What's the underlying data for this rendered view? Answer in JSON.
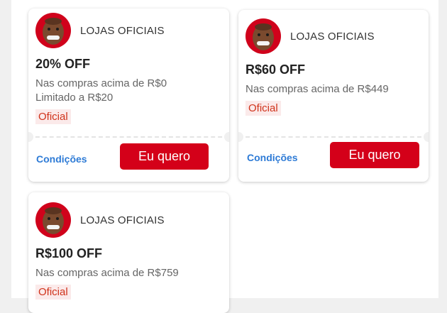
{
  "colors": {
    "brand_red": "#d40019",
    "link_blue": "#2e7bd6",
    "badge_bg": "#fbeaea",
    "badge_text": "#d0331b"
  },
  "coupons": [
    {
      "store": "LOJAS OFICIAIS",
      "avatar_icon": "store-avatar-icon",
      "title": "20% OFF",
      "desc_lines": [
        "Nas compras acima de R$0",
        "Limitado a R$20"
      ],
      "badge": "Oficial",
      "conditions_label": "Condições",
      "cta_label": "Eu quero"
    },
    {
      "store": "LOJAS OFICIAIS",
      "avatar_icon": "store-avatar-icon",
      "title": "R$60 OFF",
      "desc_lines": [
        "Nas compras acima de R$449"
      ],
      "badge": "Oficial",
      "conditions_label": "Condições",
      "cta_label": "Eu quero"
    },
    {
      "store": "LOJAS OFICIAIS",
      "avatar_icon": "store-avatar-icon",
      "title": "R$100 OFF",
      "desc_lines": [
        "Nas compras acima de R$759"
      ],
      "badge": "Oficial"
    }
  ]
}
